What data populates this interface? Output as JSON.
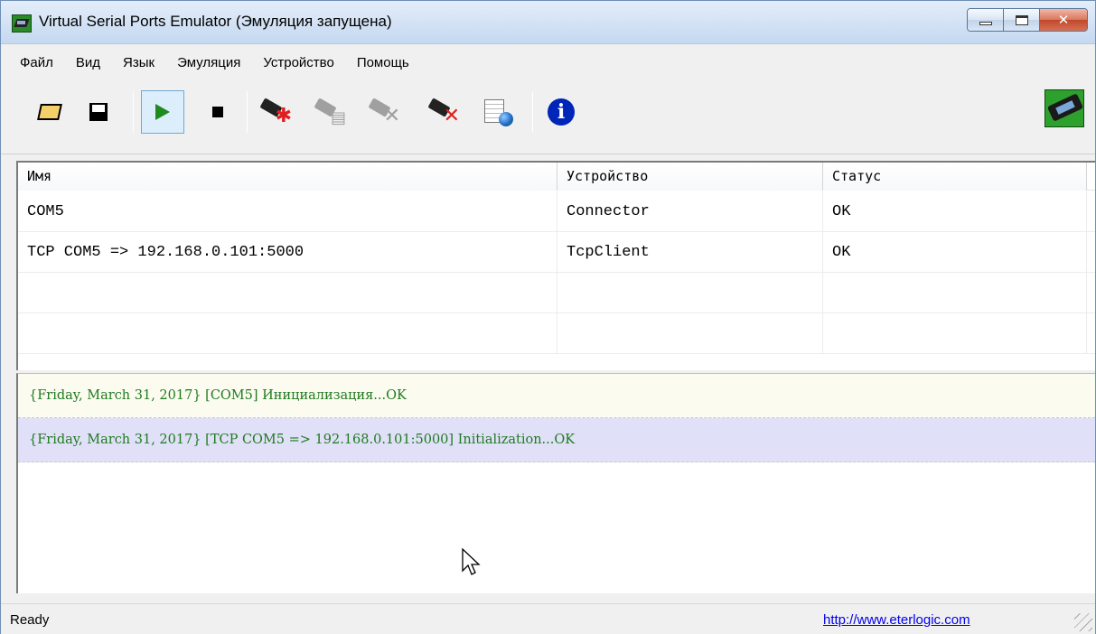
{
  "window": {
    "title": "Virtual Serial Ports Emulator (Эмуляция запущена)",
    "controls": {
      "minimize": "minimize",
      "maximize": "maximize",
      "close": "✕"
    }
  },
  "menu": [
    "Файл",
    "Вид",
    "Язык",
    "Эмуляция",
    "Устройство",
    "Помощь"
  ],
  "toolbar": {
    "buttons": [
      {
        "name": "open-icon"
      },
      {
        "name": "save-icon"
      },
      {
        "name": "start-emulation-icon",
        "active": true,
        "color": "#1f8a1f"
      },
      {
        "name": "stop-emulation-icon"
      },
      {
        "name": "create-device-icon",
        "mark": "✱",
        "mark_color": "#e02020"
      },
      {
        "name": "device-properties-icon",
        "mark": "▤",
        "mark_color": "#a0a0a0"
      },
      {
        "name": "remove-device-icon-disabled",
        "mark": "✕",
        "mark_color": "#a0a0a0"
      },
      {
        "name": "delete-device-icon",
        "mark": "✕",
        "mark_color": "#e02020"
      },
      {
        "name": "terminal-globe-icon"
      },
      {
        "name": "info-icon",
        "label": "i",
        "color": "#0026b8"
      }
    ]
  },
  "device_table": {
    "columns": [
      "Имя",
      "Устройство",
      "Статус"
    ],
    "rows": [
      [
        "COM5",
        "Connector",
        "OK"
      ],
      [
        "TCP COM5 => 192.168.0.101:5000",
        "TcpClient",
        "OK"
      ],
      [
        "",
        "",
        ""
      ],
      [
        "",
        "",
        ""
      ]
    ]
  },
  "log": [
    "{Friday, March 31, 2017} [COM5] Инициализация...OK",
    "{Friday, March 31, 2017} [TCP COM5 => 192.168.0.101:5000] Initialization...OK"
  ],
  "status": {
    "text": "Ready",
    "link": "http://www.eterlogic.com"
  },
  "colors": {
    "log_text": "#1f7a1f",
    "link": "#0000ee"
  }
}
